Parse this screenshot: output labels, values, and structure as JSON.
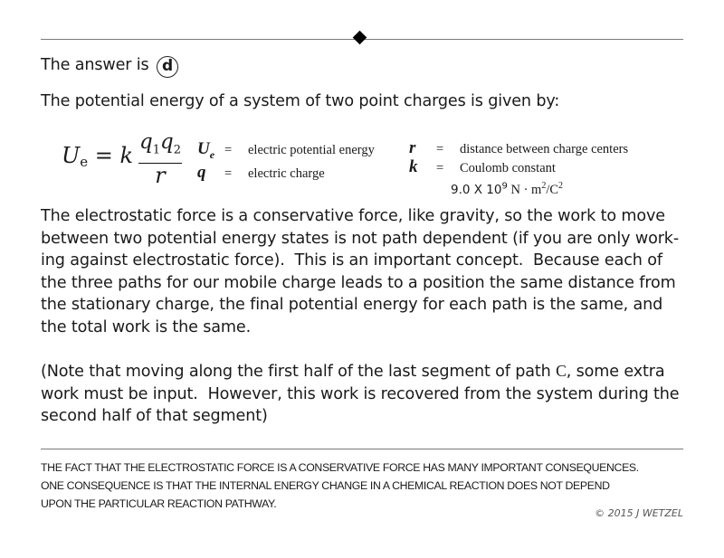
{
  "answer": {
    "prefix": "The answer is",
    "choice": "d"
  },
  "intro": "The potential energy of a system of two point charges is given by:",
  "formula": {
    "lhs_symbol": "U",
    "lhs_subscript": "e",
    "equals": "= k",
    "numerator_q1": "q",
    "numerator_q1_sub": "1",
    "numerator_q2": "q",
    "numerator_q2_sub": "2",
    "denominator": "r"
  },
  "legend": {
    "items": [
      {
        "symbol": "U",
        "subscript": "e",
        "eq": "=",
        "description": "electric potential energy"
      },
      {
        "symbol": "q",
        "eq": "=",
        "description": "electric charge"
      },
      {
        "symbol": "r",
        "eq": "=",
        "description": "distance between charge centers"
      },
      {
        "symbol": "k",
        "eq": "=",
        "description": "Coulomb constant"
      }
    ],
    "coulomb_value": "9.0 X 10",
    "coulomb_exponent": "9",
    "coulomb_unit_a": " N · m",
    "coulomb_unit_exp1": "2",
    "coulomb_unit_b": "/C",
    "coulomb_unit_exp2": "2"
  },
  "paragraphs": {
    "p1": [
      "The electrostatic force is a conservative force, like gravity, so the work to move",
      "between two potential energy states is not path dependent (if you are only work-",
      "ing against electrostatic force).  This is an important concept.  Because each of",
      "the three paths for our mobile charge leads to a position the same distance from",
      "the stationary charge, the final potential energy for each path is the same, and",
      "the total work is the same."
    ],
    "p2_start": "(Note that moving along the first half of the last segment of path ",
    "p2_path": "C",
    "p2_line1_end": ", some extra",
    "p2_line2": "work must be input.  However, this work is recovered from the system during the",
    "p2_line3": "second half of that segment)"
  },
  "footer": {
    "lines": [
      "THE FACT THAT THE ELECTROSTATIC FORCE IS A CONSERVATIVE FORCE HAS MANY IMPORTANT CONSEQUENCES.",
      "ONE CONSEQUENCE IS THAT THE INTERNAL ENERGY CHANGE IN A CHEMICAL REACTION DOES NOT DEPEND",
      "UPON THE PARTICULAR REACTION PATHWAY."
    ],
    "copyright": "© 2015 J WETZEL"
  }
}
